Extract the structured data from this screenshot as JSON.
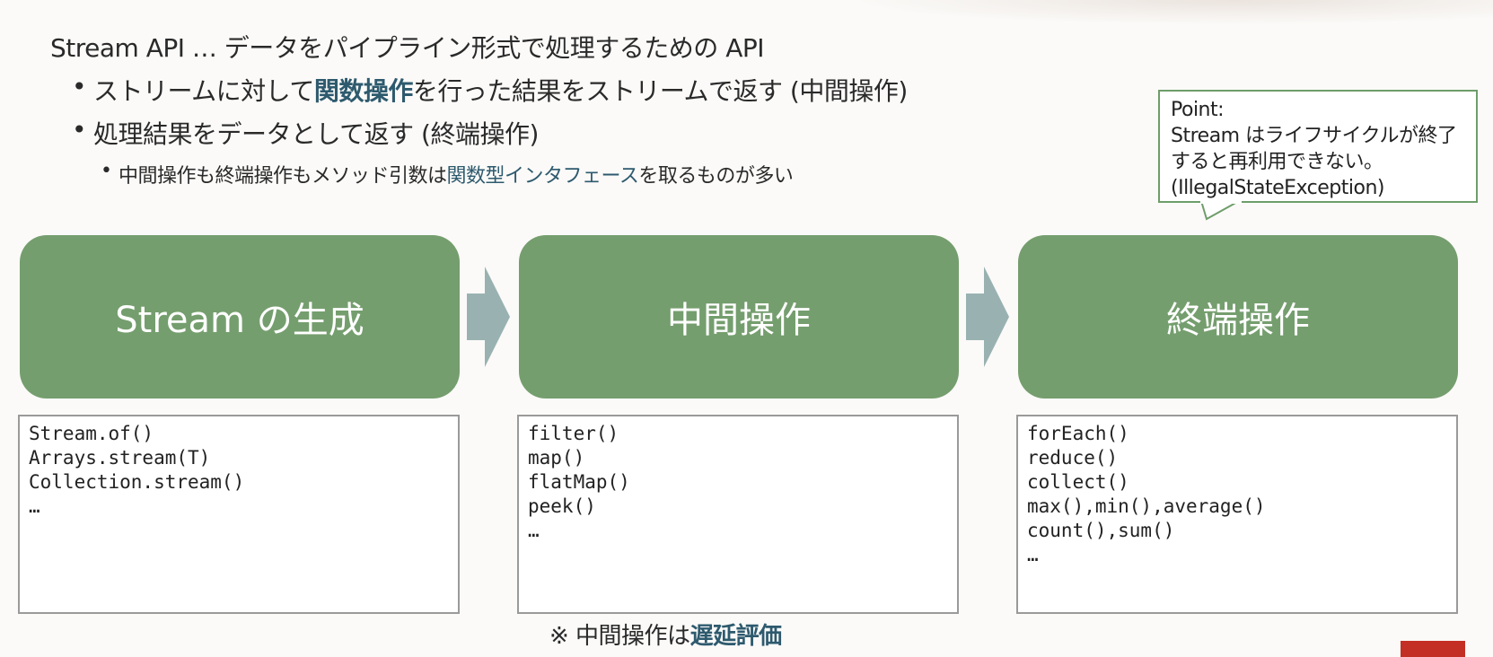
{
  "headline": "Stream API … データをパイプライン形式で処理するための API",
  "bullets": [
    {
      "text_pre": "ストリームに対して",
      "text_highlight": "関数操作",
      "text_post": "を行った結果をストリームで返す (中間操作)"
    },
    {
      "text": "処理結果をデータとして返す (終端操作)"
    }
  ],
  "sub_bullet": {
    "text_pre": "中間操作も終端操作もメソッド引数は",
    "text_highlight": "関数型インタフェース",
    "text_post": "を取るものが多い"
  },
  "bullet_char": "•",
  "callout": {
    "lines": [
      "Point:",
      "Stream はライフサイクルが終了",
      "すると再利用できない。",
      "(IllegalStateException)"
    ]
  },
  "stages": [
    {
      "label": "Stream の生成",
      "methods": [
        "Stream.of()",
        "Arrays.stream(T)",
        "Collection.stream()",
        "…"
      ]
    },
    {
      "label": "中間操作",
      "methods": [
        "filter()",
        "map()",
        "flatMap()",
        "peek()",
        "…"
      ]
    },
    {
      "label": "終端操作",
      "methods": [
        "forEach()",
        "reduce()",
        "collect()",
        "max(),min(),average()",
        "count(),sum()",
        "…"
      ]
    }
  ],
  "note": {
    "text_pre": "※ 中間操作は",
    "text_highlight": "遅延評価"
  },
  "colors": {
    "stage_fill": "#759e6e",
    "arrow_fill": "#99b2b1",
    "highlight": "#2e5a6e",
    "callout_border": "#6e9d6a",
    "accent_red": "#c42f25"
  },
  "icons": [
    "right-arrow-icon",
    "right-arrow-icon"
  ]
}
